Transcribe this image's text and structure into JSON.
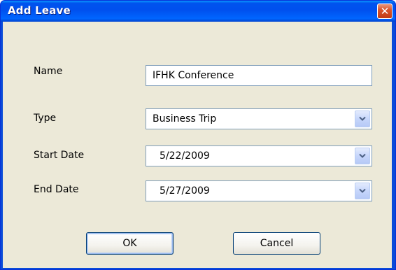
{
  "window": {
    "title": "Add Leave",
    "close_icon": "close-icon"
  },
  "form": {
    "name": {
      "label": "Name",
      "value": "IFHK Conference"
    },
    "type": {
      "label": "Type",
      "value": "Business Trip",
      "icon": "chevron-down-icon"
    },
    "start_date": {
      "label": "Start Date",
      "value": "5/22/2009",
      "icon": "chevron-down-icon"
    },
    "end_date": {
      "label": "End Date",
      "value": "5/27/2009",
      "icon": "chevron-down-icon"
    }
  },
  "buttons": {
    "ok_label": "OK",
    "cancel_label": "Cancel"
  },
  "colors": {
    "titlebar": "#0053ee",
    "client_bg": "#ece9d8",
    "close_button": "#d9542b",
    "input_border": "#7f9db9",
    "dropdown_button": "#c6d6fb"
  }
}
